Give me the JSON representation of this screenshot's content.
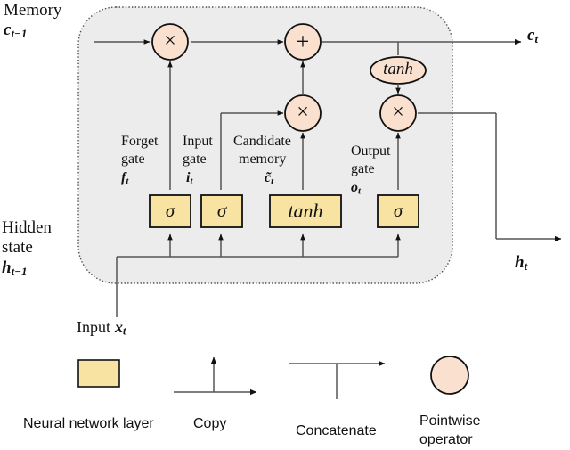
{
  "figure": {
    "title": "LSTM cell diagram",
    "colors": {
      "cell_background": "#ececec",
      "cell_border": "#4d4d4d",
      "pointwise_fill": "#fae0ce",
      "pointwise_stroke": "#111111",
      "layer_fill": "#f8e3a3",
      "layer_stroke": "#111111",
      "line": "#555555",
      "text": "#111111"
    }
  },
  "io_labels": {
    "memory_in_title": "Memory",
    "memory_in_symbol": "c",
    "memory_in_sub": "t−1",
    "memory_out_symbol": "c",
    "memory_out_sub": "t",
    "hidden_in_title_line1": "Hidden",
    "hidden_in_title_line2": "state",
    "hidden_in_symbol": "h",
    "hidden_in_sub": "t−1",
    "hidden_out_symbol": "h",
    "hidden_out_sub": "t",
    "input_title": "Input",
    "input_symbol": "x",
    "input_sub": "t"
  },
  "gates": [
    {
      "id": "forget",
      "name_line1": "Forget",
      "name_line2": "gate",
      "symbol": "f",
      "sub": "t",
      "activation": "σ"
    },
    {
      "id": "input",
      "name_line1": "Input",
      "name_line2": "gate",
      "symbol": "i",
      "sub": "t",
      "activation": "σ"
    },
    {
      "id": "candidate",
      "name_line1": "Candidate",
      "name_line2": "memory",
      "symbol": "c̃",
      "sub": "t",
      "activation": "tanh"
    },
    {
      "id": "output",
      "name_line1": "Output",
      "name_line2": "gate",
      "symbol": "o",
      "sub": "t",
      "activation": "σ"
    }
  ],
  "operators": [
    {
      "id": "forget-multiply",
      "glyph": "×"
    },
    {
      "id": "add",
      "glyph": "+"
    },
    {
      "id": "candidate-multiply",
      "glyph": "×"
    },
    {
      "id": "output-multiply",
      "glyph": "×"
    },
    {
      "id": "cell-tanh",
      "glyph": "tanh"
    }
  ],
  "legend": [
    {
      "id": "neural-network-layer",
      "label_line1": "Neural network layer",
      "label_line2": "",
      "icon": "yellow-rectangle"
    },
    {
      "id": "copy",
      "label_line1": "Copy",
      "label_line2": "",
      "icon": "copy-arrow"
    },
    {
      "id": "concatenate",
      "label_line1": "Concatenate",
      "label_line2": "",
      "icon": "concatenate-arrow"
    },
    {
      "id": "pointwise-operator",
      "label_line1": "Pointwise",
      "label_line2": "operator",
      "icon": "peach-circle"
    }
  ]
}
